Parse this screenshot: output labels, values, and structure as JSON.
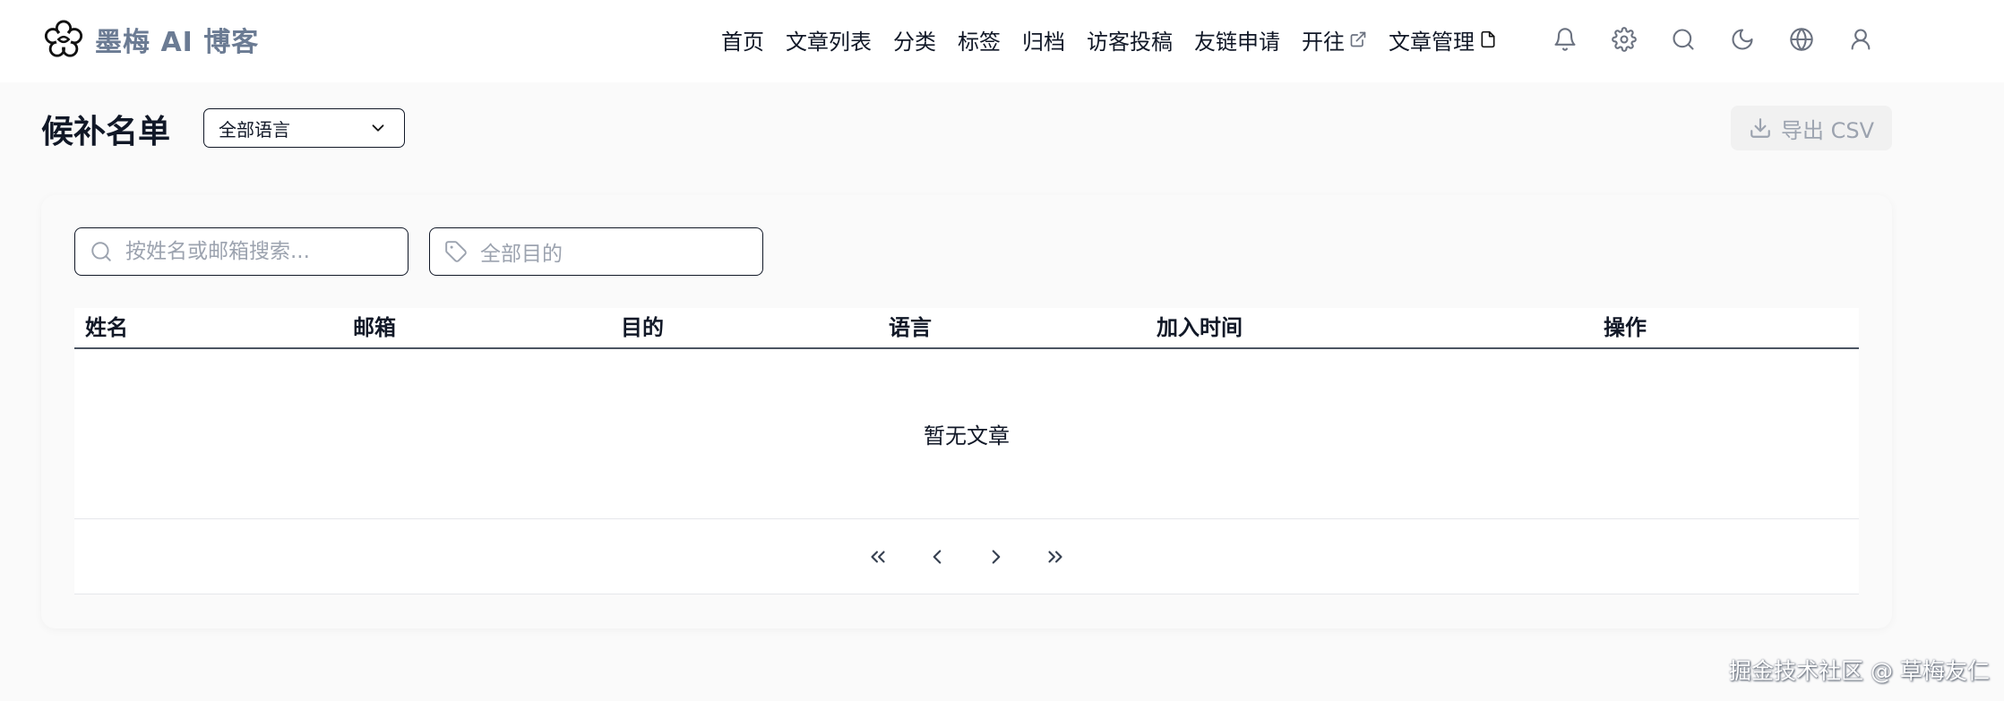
{
  "brand": {
    "name": "墨梅 AI 博客",
    "logo_icon": "plum-blossom-logo"
  },
  "nav": {
    "items": [
      {
        "label": "首页"
      },
      {
        "label": "文章列表"
      },
      {
        "label": "分类"
      },
      {
        "label": "标签"
      },
      {
        "label": "归档"
      },
      {
        "label": "访客投稿"
      },
      {
        "label": "友链申请"
      },
      {
        "label": "开往",
        "icon": "external-link-icon"
      },
      {
        "label": "文章管理",
        "icon": "file-icon"
      }
    ],
    "icons": [
      "bell-icon",
      "gear-icon",
      "search-icon",
      "moon-icon",
      "globe-icon",
      "user-icon"
    ]
  },
  "page": {
    "title": "候补名单",
    "language_select": {
      "value": "全部语言"
    },
    "export_label": "导出 CSV"
  },
  "filters": {
    "search_placeholder": "按姓名或邮箱搜索...",
    "purpose_placeholder": "全部目的"
  },
  "table": {
    "columns": [
      "姓名",
      "邮箱",
      "目的",
      "语言",
      "加入时间",
      "操作"
    ],
    "rows": [],
    "empty_text": "暂无文章"
  },
  "pagination": {
    "buttons": [
      "first-page-icon",
      "prev-page-icon",
      "next-page-icon",
      "last-page-icon"
    ]
  },
  "watermark": "掘金技术社区 @ 草梅友仁",
  "colors": {
    "brand": "#6b7b93",
    "text": "#111827",
    "muted": "#9ca3af",
    "background": "#fafafa"
  }
}
